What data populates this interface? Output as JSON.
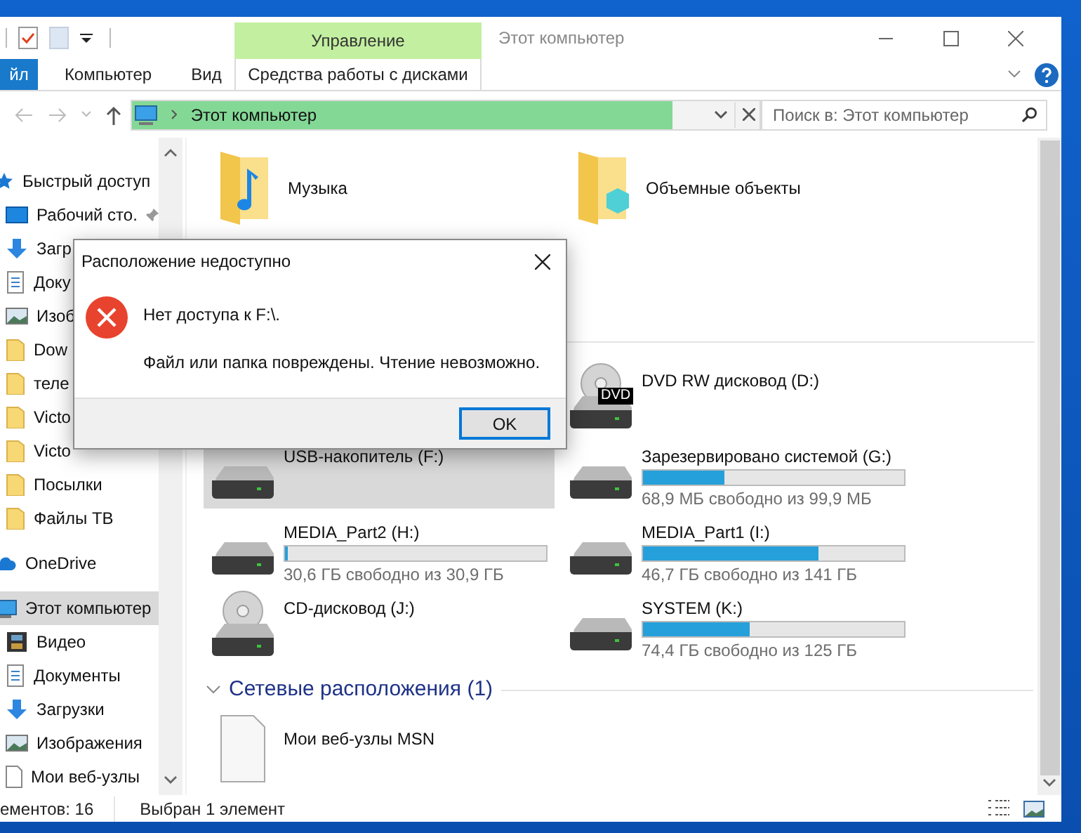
{
  "window": {
    "title": "Этот компьютер"
  },
  "ribbon": {
    "contextual_group": "Управление",
    "tabs": [
      {
        "label": "йл",
        "kind": "file"
      },
      {
        "label": "Компьютер",
        "kind": "normal"
      },
      {
        "label": "Вид",
        "kind": "normal"
      },
      {
        "label": "Средства работы с дисками",
        "kind": "contextual"
      }
    ]
  },
  "address": {
    "path": "Этот компьютер"
  },
  "search": {
    "placeholder": "Поиск в: Этот компьютер"
  },
  "sidebar": {
    "items": [
      {
        "label": "Быстрый доступ",
        "kind": "star",
        "selected": false,
        "children": [
          {
            "label": "Рабочий сто.",
            "kind": "desktop",
            "pinned": true,
            "selected": false
          },
          {
            "label": "Загр",
            "kind": "download",
            "pinned": false,
            "selected": false
          },
          {
            "label": "Доку",
            "kind": "document",
            "pinned": false,
            "selected": false
          },
          {
            "label": "Изоб",
            "kind": "image",
            "pinned": false,
            "selected": false
          },
          {
            "label": "Dow",
            "kind": "folder",
            "pinned": false,
            "selected": false
          },
          {
            "label": "теле",
            "kind": "folder",
            "pinned": false,
            "selected": false
          },
          {
            "label": "Victo",
            "kind": "folder",
            "pinned": false,
            "selected": false
          },
          {
            "label": "Victo",
            "kind": "folder",
            "pinned": false,
            "selected": false
          },
          {
            "label": "Посылки",
            "kind": "folder",
            "pinned": false,
            "selected": false
          },
          {
            "label": "Файлы ТВ",
            "kind": "folder",
            "pinned": false,
            "selected": false
          }
        ]
      },
      {
        "label": "OneDrive",
        "kind": "cloud",
        "selected": false
      },
      {
        "label": "Этот компьютер",
        "kind": "computer",
        "selected": true,
        "children": [
          {
            "label": "Видео",
            "kind": "video",
            "pinned": false,
            "selected": false
          },
          {
            "label": "Документы",
            "kind": "document",
            "pinned": false,
            "selected": false
          },
          {
            "label": "Загрузки",
            "kind": "download",
            "pinned": false,
            "selected": false
          },
          {
            "label": "Изображения",
            "kind": "image",
            "pinned": false,
            "selected": false
          },
          {
            "label": "Мои веб-узлы",
            "kind": "file",
            "pinned": false,
            "selected": false
          }
        ]
      }
    ]
  },
  "folders": [
    {
      "name": "Музыка",
      "kind": "music"
    },
    {
      "name": "Объемные объекты",
      "kind": "cube"
    }
  ],
  "drives": [
    {
      "name": "DVD RW дисковод (D:)",
      "kind": "dvd",
      "badge": "DVD",
      "selected": false
    },
    {
      "name": "USB-накопитель (F:)",
      "kind": "hdd",
      "selected": true
    },
    {
      "name": "Зарезервировано системой (G:)",
      "kind": "hdd",
      "level": 0.31,
      "free": "68,9 МБ свободно из 99,9 МБ",
      "selected": false
    },
    {
      "name": "MEDIA_Part2 (H:)",
      "kind": "hdd",
      "level": 0.01,
      "free": "30,6 ГБ свободно из 30,9 ГБ",
      "selected": false
    },
    {
      "name": "MEDIA_Part1 (I:)",
      "kind": "hdd",
      "level": 0.67,
      "free": "46,7 ГБ свободно из 141 ГБ",
      "selected": false
    },
    {
      "name": "CD-дисковод (J:)",
      "kind": "cd",
      "selected": false
    },
    {
      "name": "SYSTEM (K:)",
      "kind": "hdd",
      "level": 0.41,
      "free": "74,4 ГБ свободно из 125 ГБ",
      "selected": false
    }
  ],
  "network": {
    "title": "Сетевые расположения (1)",
    "expanded": true,
    "items": [
      {
        "name": "Мои веб-узлы MSN"
      }
    ]
  },
  "status_bar": [
    "ементов: 16",
    "Выбран 1 элемент"
  ],
  "dialog": {
    "title": "Расположение недоступно",
    "heading": "Нет доступа к F:\\.",
    "message": "Файл или папка повреждены. Чтение невозможно.",
    "button": "OK"
  }
}
